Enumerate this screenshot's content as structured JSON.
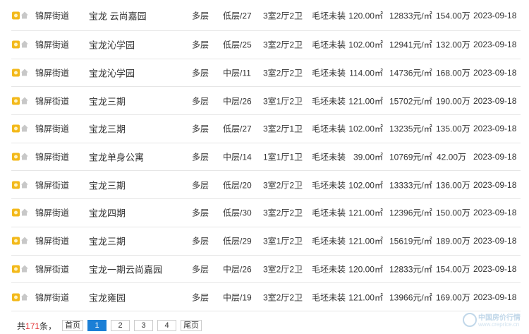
{
  "listings": [
    {
      "street": "锦屏街道",
      "name": "宝龙 云尚嘉园",
      "type": "多层",
      "floor": "低层/27",
      "layout": "3室2厅2卫",
      "decoration": "毛坯未装",
      "area": "120.00㎡",
      "unit_price": "12833元/㎡",
      "total_price": "154.00万",
      "date": "2023-09-18"
    },
    {
      "street": "锦屏街道",
      "name": "宝龙沁学园",
      "type": "多层",
      "floor": "低层/25",
      "layout": "3室2厅2卫",
      "decoration": "毛坯未装",
      "area": "102.00㎡",
      "unit_price": "12941元/㎡",
      "total_price": "132.00万",
      "date": "2023-09-18"
    },
    {
      "street": "锦屏街道",
      "name": "宝龙沁学园",
      "type": "多层",
      "floor": "中层/11",
      "layout": "3室2厅2卫",
      "decoration": "毛坯未装",
      "area": "114.00㎡",
      "unit_price": "14736元/㎡",
      "total_price": "168.00万",
      "date": "2023-09-18"
    },
    {
      "street": "锦屏街道",
      "name": "宝龙三期",
      "type": "多层",
      "floor": "中层/26",
      "layout": "3室1厅2卫",
      "decoration": "毛坯未装",
      "area": "121.00㎡",
      "unit_price": "15702元/㎡",
      "total_price": "190.00万",
      "date": "2023-09-18"
    },
    {
      "street": "锦屏街道",
      "name": "宝龙三期",
      "type": "多层",
      "floor": "低层/27",
      "layout": "3室2厅1卫",
      "decoration": "毛坯未装",
      "area": "102.00㎡",
      "unit_price": "13235元/㎡",
      "total_price": "135.00万",
      "date": "2023-09-18"
    },
    {
      "street": "锦屏街道",
      "name": "宝龙单身公寓",
      "type": "多层",
      "floor": "中层/14",
      "layout": "1室1厅1卫",
      "decoration": "毛坯未装",
      "area": "39.00㎡",
      "unit_price": "10769元/㎡",
      "total_price": "42.00万",
      "date": "2023-09-18"
    },
    {
      "street": "锦屏街道",
      "name": "宝龙三期",
      "type": "多层",
      "floor": "低层/20",
      "layout": "3室2厅2卫",
      "decoration": "毛坯未装",
      "area": "102.00㎡",
      "unit_price": "13333元/㎡",
      "total_price": "136.00万",
      "date": "2023-09-18"
    },
    {
      "street": "锦屏街道",
      "name": "宝龙四期",
      "type": "多层",
      "floor": "低层/30",
      "layout": "3室2厅2卫",
      "decoration": "毛坯未装",
      "area": "121.00㎡",
      "unit_price": "12396元/㎡",
      "total_price": "150.00万",
      "date": "2023-09-18"
    },
    {
      "street": "锦屏街道",
      "name": "宝龙三期",
      "type": "多层",
      "floor": "低层/29",
      "layout": "3室1厅2卫",
      "decoration": "毛坯未装",
      "area": "121.00㎡",
      "unit_price": "15619元/㎡",
      "total_price": "189.00万",
      "date": "2023-09-18"
    },
    {
      "street": "锦屏街道",
      "name": "宝龙一期云尚嘉园",
      "type": "多层",
      "floor": "中层/26",
      "layout": "3室2厅2卫",
      "decoration": "毛坯未装",
      "area": "120.00㎡",
      "unit_price": "12833元/㎡",
      "total_price": "154.00万",
      "date": "2023-09-18"
    },
    {
      "street": "锦屏街道",
      "name": "宝龙雍园",
      "type": "多层",
      "floor": "中层/19",
      "layout": "3室2厅2卫",
      "decoration": "毛坯未装",
      "area": "121.00㎡",
      "unit_price": "13966元/㎡",
      "total_price": "169.00万",
      "date": "2023-09-18"
    }
  ],
  "icons": {
    "photo": "photo-icon",
    "house": "house-icon"
  },
  "pagination": {
    "prefix": "共",
    "total": "171",
    "suffix": "条，",
    "first_label": "首页",
    "pages": [
      "1",
      "2",
      "3",
      "4"
    ],
    "current_page": "1",
    "last_label": "尾页"
  },
  "colors": {
    "accent": "#1b7fd6",
    "count": "#e4393c",
    "icon": "#f3b91b"
  },
  "watermark": {
    "text": "中国房价行情",
    "url": "www.creprice.cn"
  }
}
